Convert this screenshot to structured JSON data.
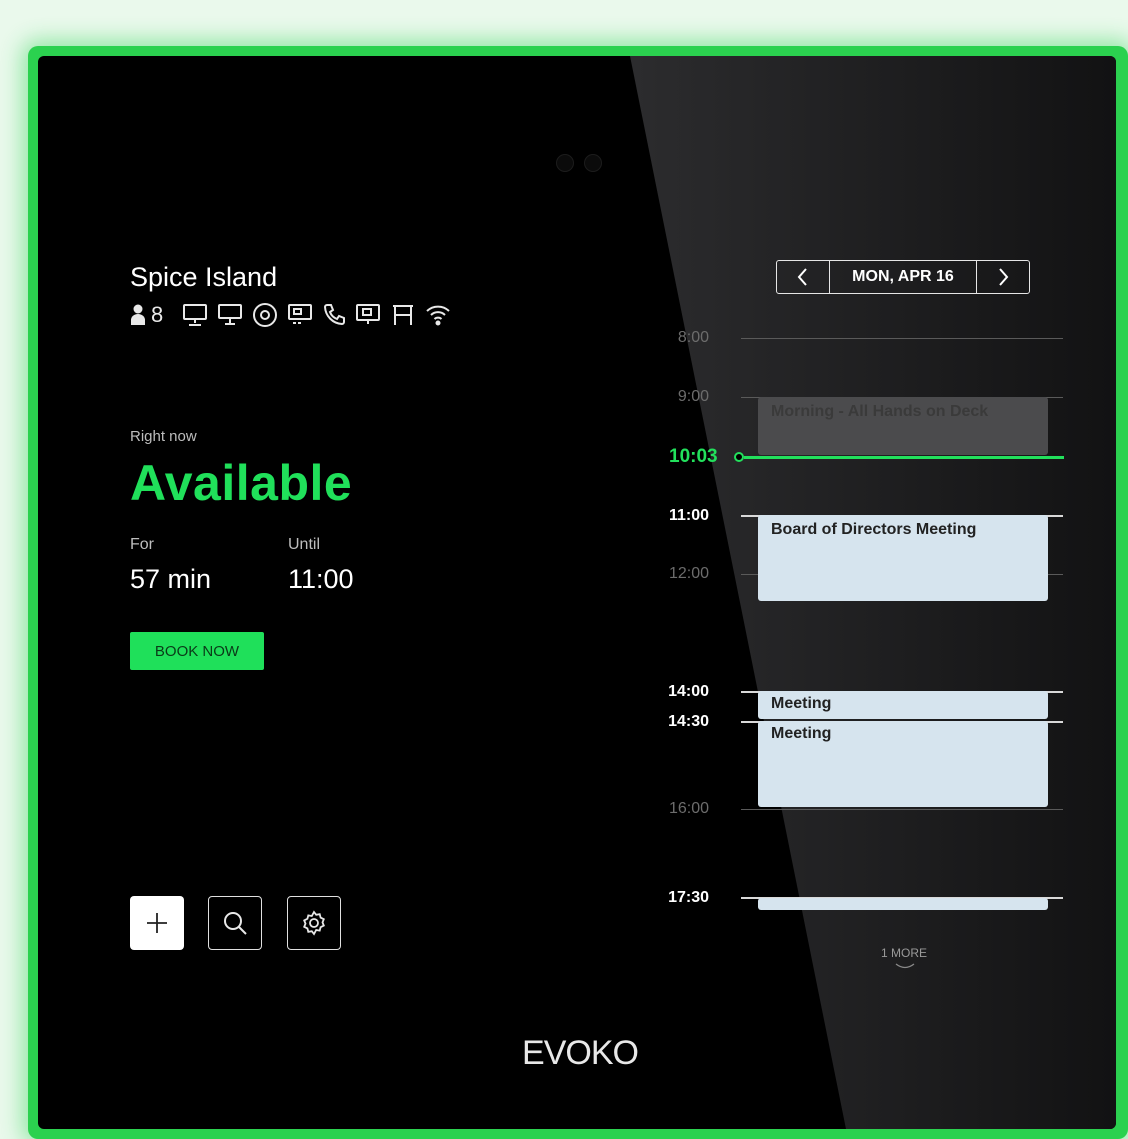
{
  "brand": {
    "logo": "EVOKO",
    "accent": "#22e05c"
  },
  "room": {
    "name": "Spice Island",
    "capacity": "8",
    "amenities": [
      "person-icon",
      "monitor-icon",
      "display-icon",
      "webcam-icon",
      "video-conference-icon",
      "phone-icon",
      "presentation-icon",
      "whiteboard-icon",
      "wifi-icon"
    ]
  },
  "status": {
    "right_now_label": "Right now",
    "state": "Available",
    "for_label": "For",
    "for_value": "57 min",
    "until_label": "Until",
    "until_value": "11:00",
    "book_button": "BOOK NOW"
  },
  "toolbar": [
    "add-icon",
    "search-icon",
    "settings-icon"
  ],
  "calendar": {
    "date": "MON, APR 16",
    "prev_icon": "chevron-left-icon",
    "next_icon": "chevron-right-icon",
    "current_time": "10:03",
    "time_labels": {
      "t0800": "8:00",
      "t0900": "9:00",
      "t1100": "11:00",
      "t1200": "12:00",
      "t1400": "14:00",
      "t1430": "14:30",
      "t1600": "16:00",
      "t1730": "17:30"
    },
    "events": [
      {
        "title": "Morning - All Hands on Deck",
        "start": "9:00",
        "end": "10:00",
        "state": "past"
      },
      {
        "title": "Board of Directors Meeting",
        "start": "11:00",
        "end": "12:30",
        "state": "upcoming"
      },
      {
        "title": "Meeting",
        "start": "14:00",
        "end": "14:30",
        "state": "upcoming"
      },
      {
        "title": "Meeting",
        "start": "14:30",
        "end": "16:00",
        "state": "upcoming"
      },
      {
        "title": "",
        "start": "17:30",
        "end": "",
        "state": "upcoming"
      }
    ],
    "more_label": "1 MORE"
  }
}
